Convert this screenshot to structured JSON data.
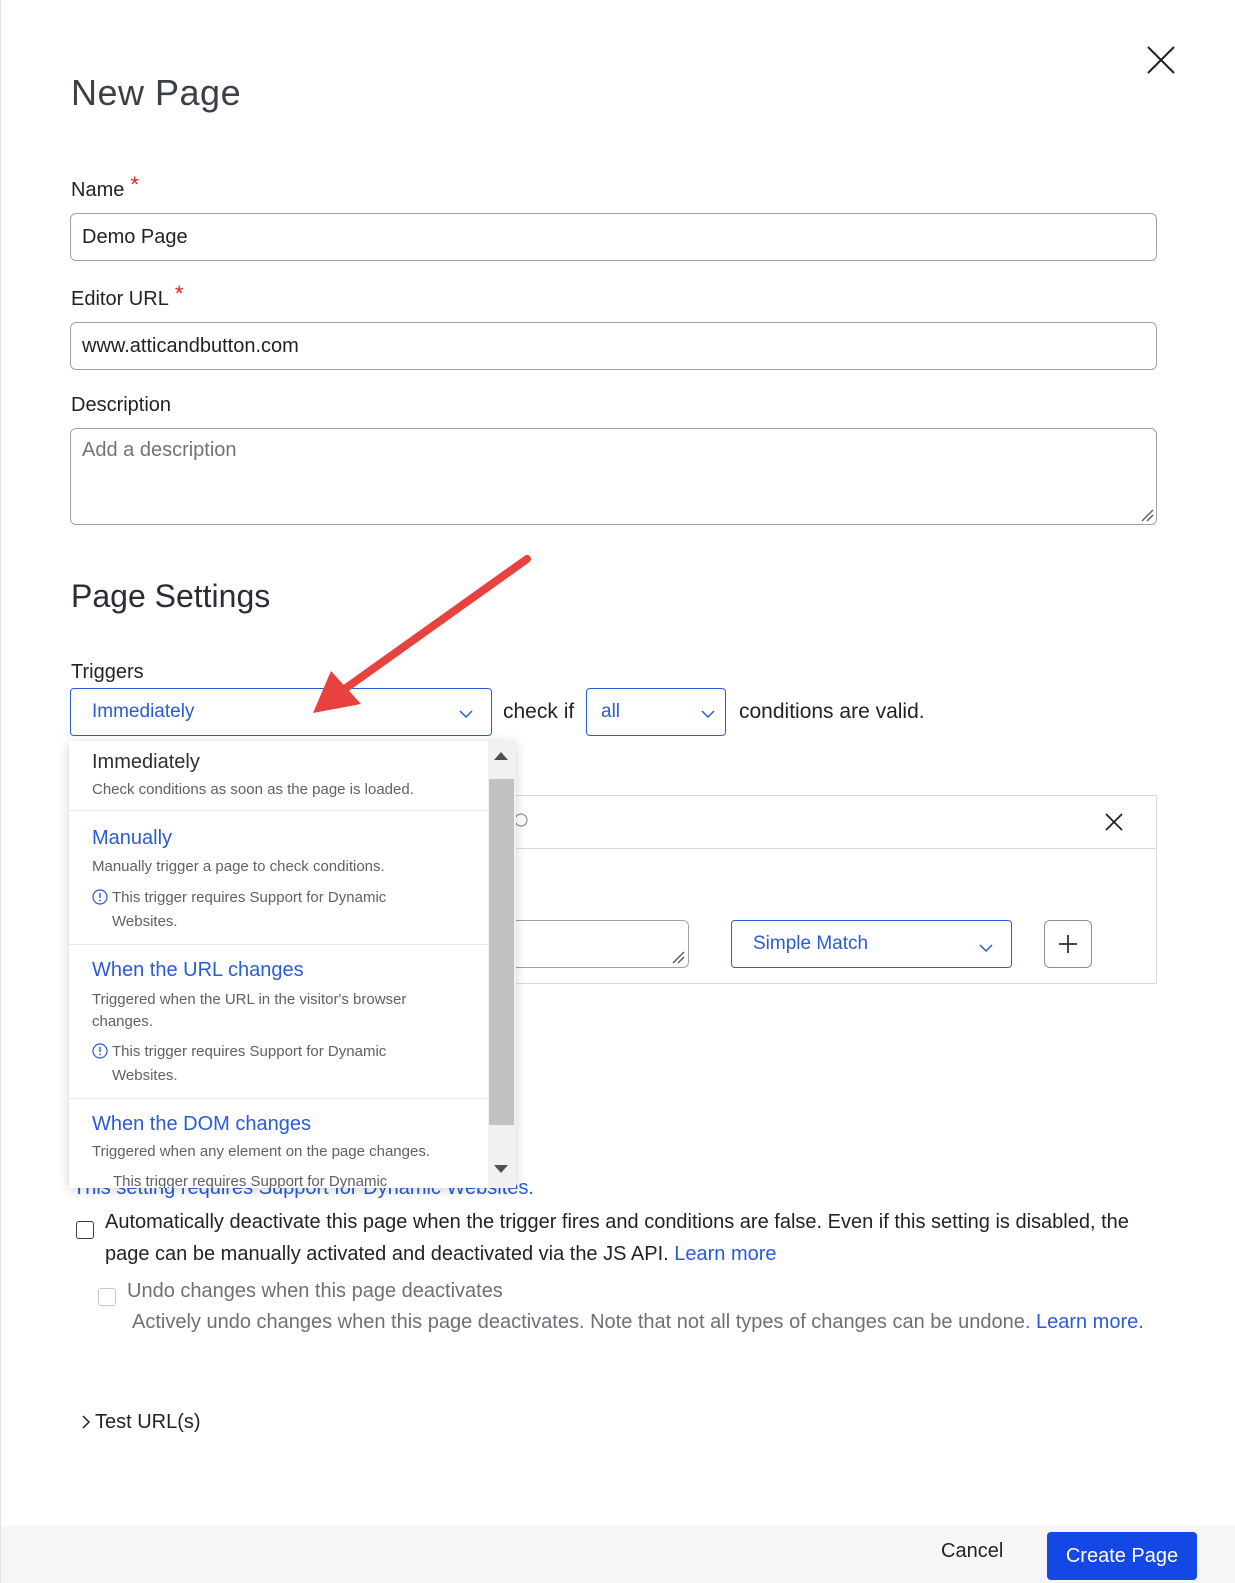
{
  "dialog": {
    "title": "New Page"
  },
  "form": {
    "name_label": "Name",
    "name_value": "Demo Page",
    "editor_url_label": "Editor URL",
    "editor_url_value": "www.atticandbutton.com",
    "description_label": "Description",
    "description_placeholder": "Add a description",
    "required_mark": "*"
  },
  "page_settings": {
    "title": "Page Settings",
    "triggers_label": "Triggers",
    "trigger_selected": "Immediately",
    "check_if_text": "check if",
    "condition_mode_selected": "all",
    "conditions_suffix": "conditions are valid.",
    "match_type_selected": "Simple Match"
  },
  "trigger_dropdown": {
    "options": [
      {
        "title": "Immediately",
        "description": "Check conditions as soon as the page is loaded.",
        "note": ""
      },
      {
        "title": "Manually",
        "description": "Manually trigger a page to check conditions.",
        "note": "This trigger requires Support for Dynamic Websites."
      },
      {
        "title": "When the URL changes",
        "description": "Triggered when the URL in the visitor's browser changes.",
        "note": "This trigger requires Support for Dynamic Websites."
      },
      {
        "title": "When the DOM changes",
        "description": "Triggered when any element on the page changes.",
        "note": "This trigger requires Support for Dynamic"
      }
    ]
  },
  "behind_dropdown_text": "This setting requires Support for Dynamic Websites.",
  "auto_deactivate": {
    "text": "Automatically deactivate this page when the trigger fires and conditions are false. Even if this setting is disabled, the page can be manually activated and deactivated via the JS API.",
    "link": "Learn more"
  },
  "undo_changes": {
    "label": "Undo changes when this page deactivates",
    "description": "Actively undo changes when this page deactivates. Note that not all types of changes can be undone.",
    "link": "Learn more."
  },
  "test_urls": {
    "label": "Test URL(s)"
  },
  "footer": {
    "cancel_label": "Cancel",
    "create_label": "Create Page"
  },
  "colors": {
    "accent": "#2a5bd7",
    "primary_button": "#1347e6",
    "required": "#dd2222",
    "annotation_arrow": "#e8423f"
  }
}
